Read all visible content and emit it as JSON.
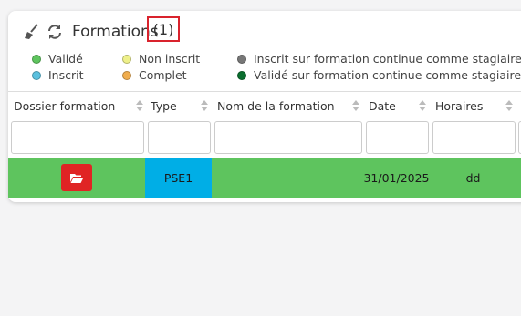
{
  "header": {
    "title": "Formations",
    "count": "(1)"
  },
  "legend": [
    {
      "label": "Validé",
      "color": "#5ec45e"
    },
    {
      "label": "Inscrit",
      "color": "#5bc0de"
    },
    {
      "label": "Non inscrit",
      "color": "#eef08a"
    },
    {
      "label": "Complet",
      "color": "#f0ad4e"
    },
    {
      "label": "Inscrit sur formation continue comme stagiaire",
      "color": "#777777"
    },
    {
      "label": "Validé sur formation continue comme stagiaire",
      "color": "#0a6e2e"
    }
  ],
  "table": {
    "columns": [
      {
        "label": "Dossier formation"
      },
      {
        "label": "Type"
      },
      {
        "label": "Nom de la formation"
      },
      {
        "label": "Date"
      },
      {
        "label": "Horaires"
      }
    ],
    "rows": [
      {
        "type": "PSE1",
        "nom": "",
        "date": "31/01/2025",
        "horaires": "dd",
        "status_color": "#5ec45e",
        "type_color": "#00aee6"
      }
    ]
  },
  "icons": {
    "clear": "broom-icon",
    "refresh": "refresh-icon",
    "folder": "folder-open-icon",
    "sort": "sort-icon"
  }
}
